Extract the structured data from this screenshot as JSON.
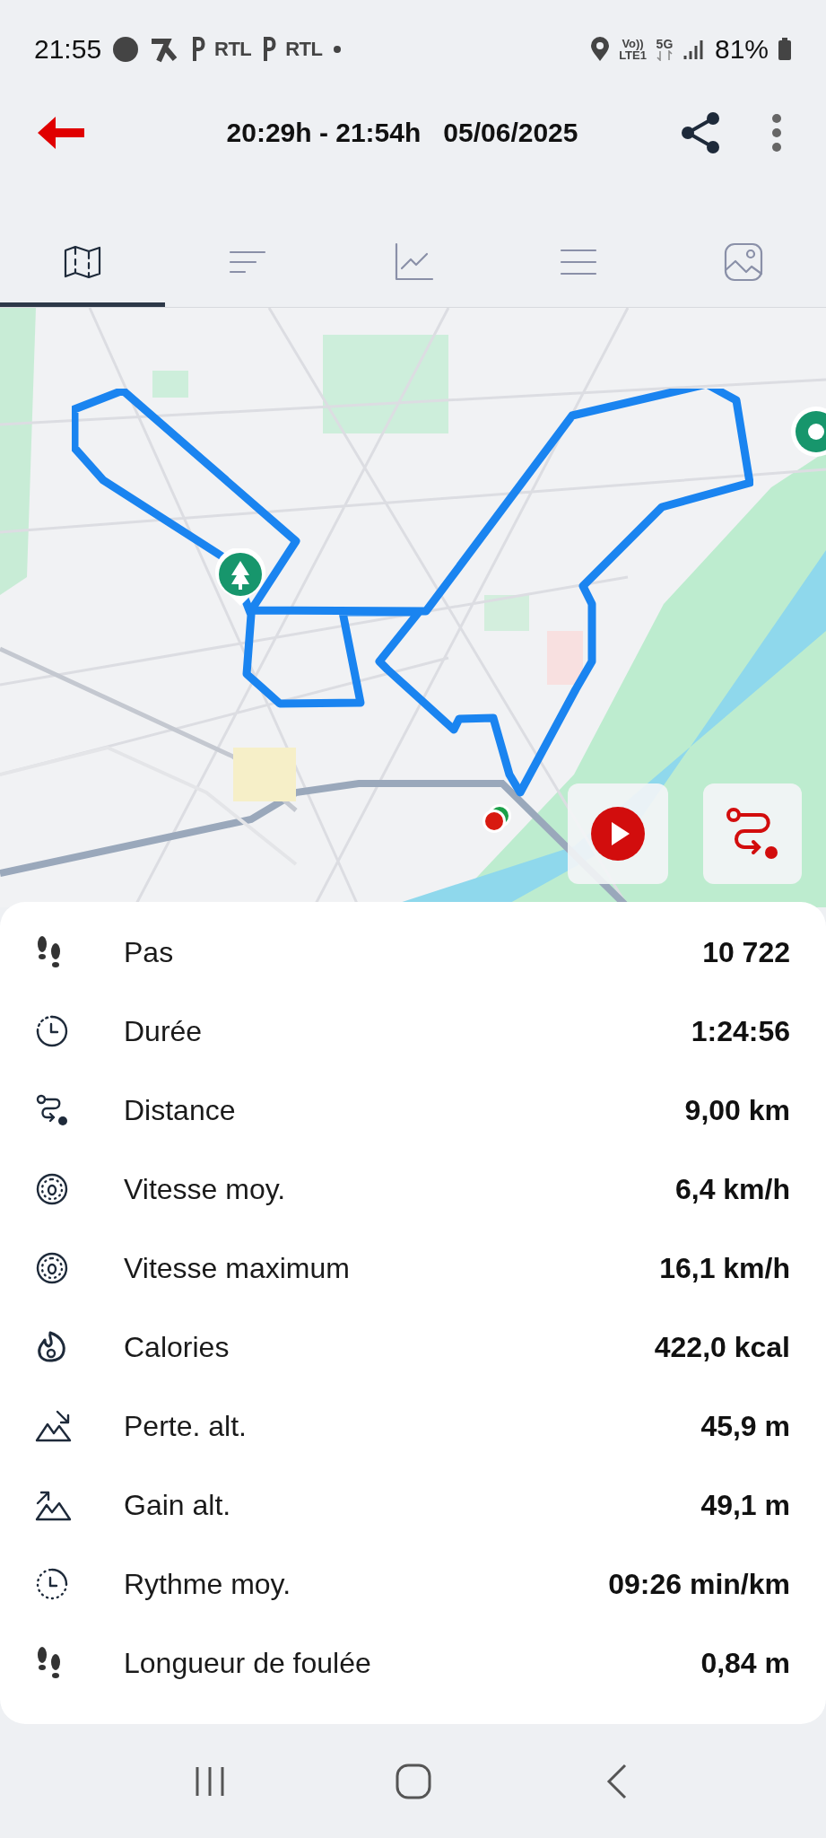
{
  "status_bar": {
    "time": "21:55",
    "notifications": [
      "RTL",
      "RTL"
    ],
    "network": [
      "Vo))",
      "LTE1",
      "5G"
    ],
    "battery": "81%"
  },
  "header": {
    "title": "20:29h - 21:54h   05/06/2025"
  },
  "tabs": [
    {
      "kind": "map",
      "selected": true
    },
    {
      "kind": "sort",
      "selected": false
    },
    {
      "kind": "chart",
      "selected": false
    },
    {
      "kind": "list",
      "selected": false
    },
    {
      "kind": "photo",
      "selected": false
    }
  ],
  "stats": [
    {
      "kind": "steps",
      "label": "Pas",
      "value": "10 722"
    },
    {
      "kind": "clock",
      "label": "Durée",
      "value": "1:24:56"
    },
    {
      "kind": "route",
      "label": "Distance",
      "value": "9,00 km"
    },
    {
      "kind": "speed",
      "label": "Vitesse moy.",
      "value": "6,4 km/h"
    },
    {
      "kind": "speed",
      "label": "Vitesse maximum",
      "value": "16,1 km/h"
    },
    {
      "kind": "flame",
      "label": "Calories",
      "value": "422,0 kcal"
    },
    {
      "kind": "descent",
      "label": "Perte. alt.",
      "value": "45,9 m"
    },
    {
      "kind": "ascent",
      "label": "Gain alt.",
      "value": "49,1 m"
    },
    {
      "kind": "pace",
      "label": "Rythme moy.",
      "value": "09:26 min/km"
    },
    {
      "kind": "steps",
      "label": "Longueur de foulée",
      "value": "0,84 m"
    }
  ]
}
